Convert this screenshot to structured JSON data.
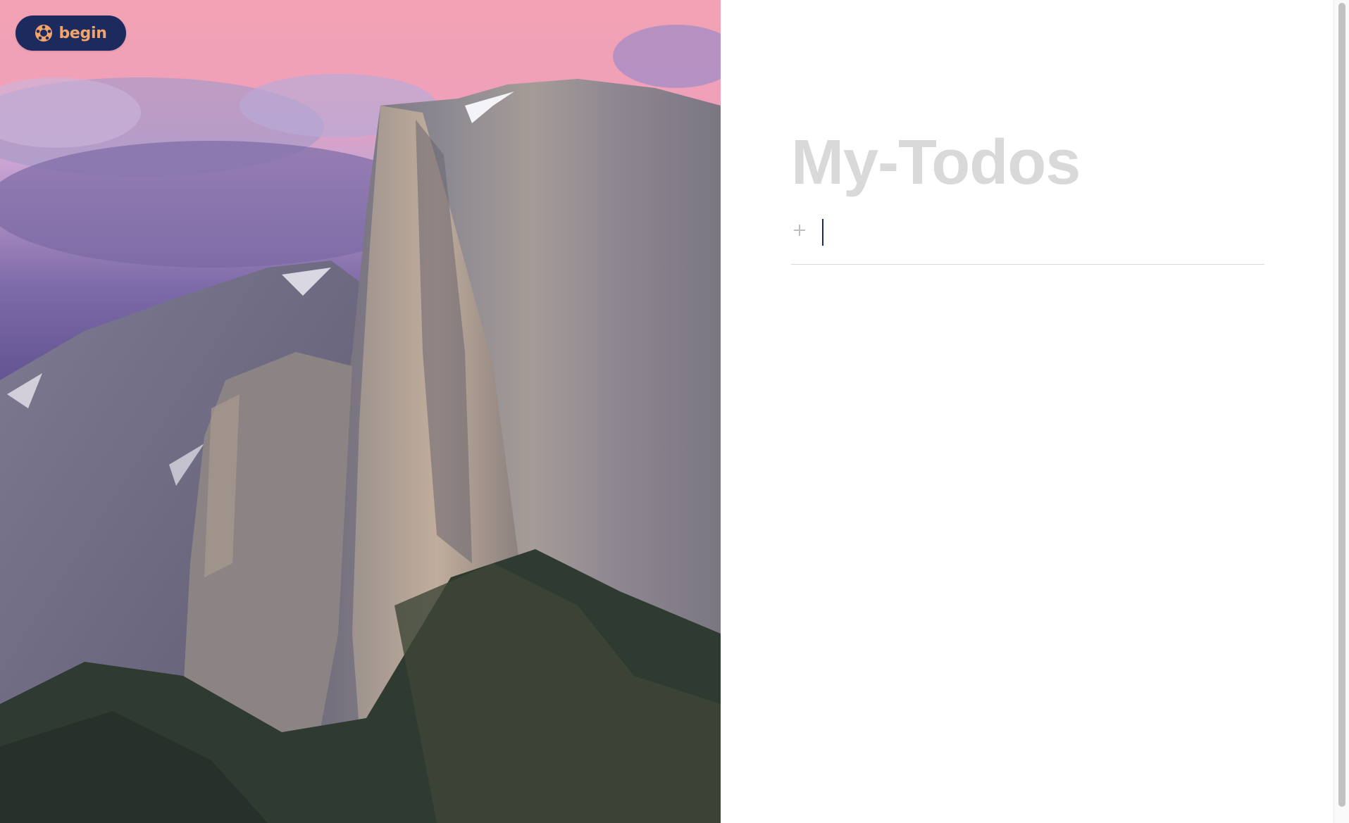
{
  "brand": {
    "label": "begin",
    "badge_color": "#1c2a5e",
    "accent_color": "#f2a46b",
    "icon": "begin-logo-icon"
  },
  "hero": {
    "icon": "mountain-landscape-image",
    "sky_colors": [
      "#f5a6b8",
      "#9b7fc0",
      "#5a4d8c"
    ]
  },
  "todos": {
    "title": "My-Todos",
    "title_color": "#d9d9d9",
    "add_icon": "plus-icon",
    "input_value": "",
    "input_placeholder": "",
    "items": []
  }
}
